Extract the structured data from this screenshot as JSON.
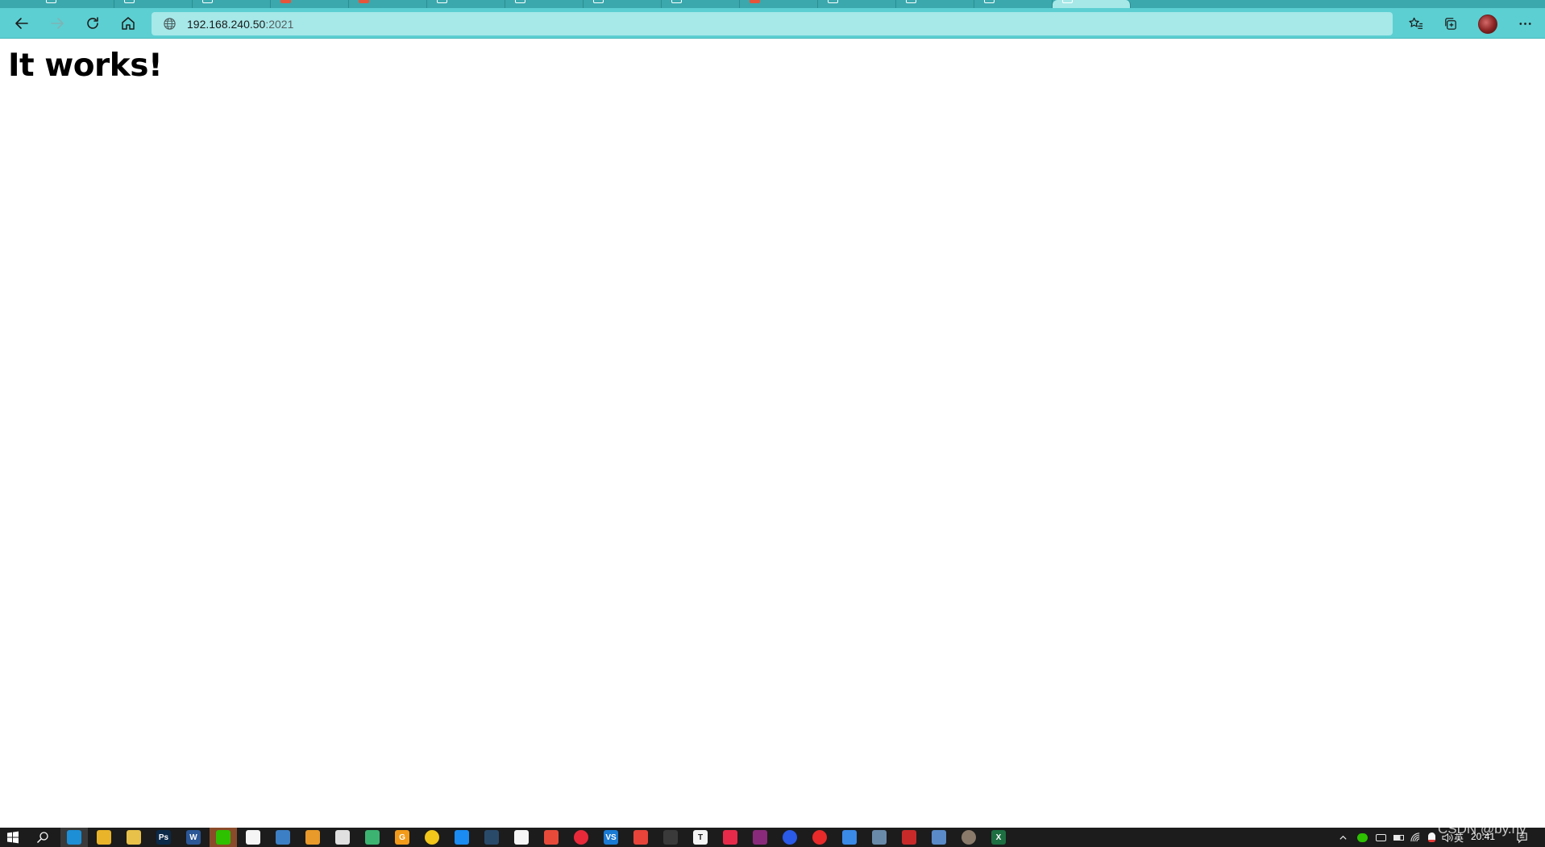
{
  "browser": {
    "address_bar": {
      "host": "192.168.240.50",
      "port": ":2021"
    },
    "colors": {
      "toolbar": "#5ccfd2",
      "address_bar": "#a7e8e9",
      "tab_strip": "#3aa8ad"
    }
  },
  "page": {
    "heading": "It works!"
  },
  "taskbar": {
    "clock": "20:41",
    "ime_indicator": "英",
    "pinned_icons": [
      {
        "name": "edge-icon",
        "color": "#1d8fd6",
        "glyph": ""
      },
      {
        "name": "chrome-icon",
        "color": "#e9b42a",
        "glyph": ""
      },
      {
        "name": "file-explorer-icon",
        "color": "#e8c14a",
        "glyph": ""
      },
      {
        "name": "photoshop-icon",
        "color": "#0b2a4a",
        "glyph": "Ps"
      },
      {
        "name": "word-icon",
        "color": "#2b5797",
        "glyph": "W"
      },
      {
        "name": "wechat-icon",
        "color": "#2dc100",
        "glyph": ""
      },
      {
        "name": "qq-icon",
        "color": "#f5f5f5",
        "glyph": ""
      },
      {
        "name": "remote-desktop-icon",
        "color": "#3d7fc4",
        "glyph": ""
      },
      {
        "name": "app-frame-icon",
        "color": "#e89a2a",
        "glyph": ""
      },
      {
        "name": "cloud-app-icon",
        "color": "#e0e0e0",
        "glyph": ""
      },
      {
        "name": "video-player-icon",
        "color": "#3cb371",
        "glyph": ""
      },
      {
        "name": "g-app-icon",
        "color": "#f29b1a",
        "glyph": "G"
      },
      {
        "name": "yellow-circle-app-icon",
        "color": "#f2c61a",
        "glyph": ""
      },
      {
        "name": "blue-chart-app-icon",
        "color": "#1a8cf2",
        "glyph": ""
      },
      {
        "name": "steam-icon",
        "color": "#2a4a6a",
        "glyph": ""
      },
      {
        "name": "document-icon",
        "color": "#f5f5f5",
        "glyph": ""
      },
      {
        "name": "colorful-grid-app-icon",
        "color": "#e84a3a",
        "glyph": ""
      },
      {
        "name": "netease-music-icon",
        "color": "#e8293a",
        "glyph": ""
      },
      {
        "name": "vscode-icon",
        "color": "#1a7ad4",
        "glyph": "VS"
      },
      {
        "name": "red-tool-icon",
        "color": "#e8443a",
        "glyph": ""
      },
      {
        "name": "terminal-app-icon",
        "color": "#3a3a3a",
        "glyph": ""
      },
      {
        "name": "typora-icon",
        "color": "#f5f5f5",
        "glyph": "T"
      },
      {
        "name": "xmind-icon",
        "color": "#e82a4a",
        "glyph": ""
      },
      {
        "name": "winrar-icon",
        "color": "#8a2a7a",
        "glyph": ""
      },
      {
        "name": "firefox-icon",
        "color": "#2a5ae8",
        "glyph": ""
      },
      {
        "name": "record-icon",
        "color": "#e82a2a",
        "glyph": ""
      },
      {
        "name": "bird-app-icon",
        "color": "#3a8ae8",
        "glyph": ""
      },
      {
        "name": "network-app-icon",
        "color": "#6a8aaa",
        "glyph": ""
      },
      {
        "name": "red-box-app-icon",
        "color": "#c82a2a",
        "glyph": ""
      },
      {
        "name": "remote-app-icon",
        "color": "#5a8ac8",
        "glyph": ""
      },
      {
        "name": "avatar-app-icon",
        "color": "#8a7a6a",
        "glyph": ""
      },
      {
        "name": "excel-icon",
        "color": "#1d6f42",
        "glyph": "X"
      }
    ]
  },
  "watermark": "CSDN @by.hy"
}
